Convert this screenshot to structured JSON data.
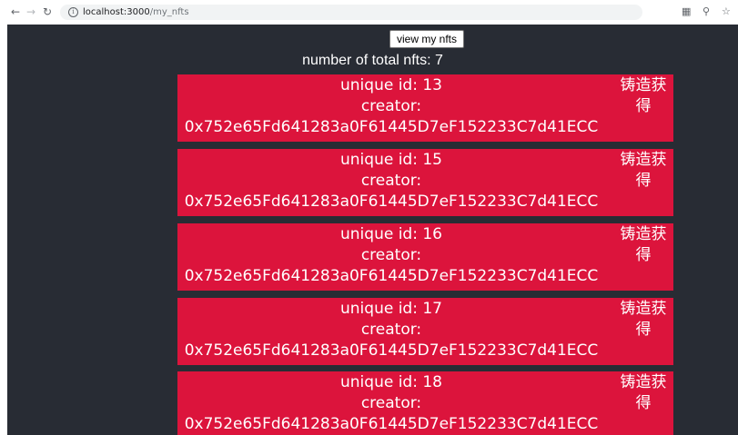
{
  "browser": {
    "url_host": "localhost:3000",
    "url_path": "/my_nfts"
  },
  "app": {
    "view_button_label": "view my nfts",
    "total_text": "number of total nfts: 7",
    "nfts": [
      {
        "id_text": "unique id: 13",
        "creator_label": "creator:",
        "creator_address": "0x752e65Fd641283a0F61445D7eF152233C7d41ECC",
        "status_line1": "铸造获",
        "status_line2": "得"
      },
      {
        "id_text": "unique id: 15",
        "creator_label": "creator:",
        "creator_address": "0x752e65Fd641283a0F61445D7eF152233C7d41ECC",
        "status_line1": "铸造获",
        "status_line2": "得"
      },
      {
        "id_text": "unique id: 16",
        "creator_label": "creator:",
        "creator_address": "0x752e65Fd641283a0F61445D7eF152233C7d41ECC",
        "status_line1": "铸造获",
        "status_line2": "得"
      },
      {
        "id_text": "unique id: 17",
        "creator_label": "creator:",
        "creator_address": "0x752e65Fd641283a0F61445D7eF152233C7d41ECC",
        "status_line1": "铸造获",
        "status_line2": "得"
      },
      {
        "id_text": "unique id: 18",
        "creator_label": "creator:",
        "creator_address": "0x752e65Fd641283a0F61445D7eF152233C7d41ECC",
        "status_line1": "铸造获",
        "status_line2": "得"
      }
    ]
  },
  "colors": {
    "background": "#282c34",
    "card": "#dc143c",
    "text": "#ffffff"
  },
  "icons": {
    "back": "arrow-left-icon",
    "forward": "arrow-right-icon",
    "reload": "reload-icon",
    "info": "info-icon",
    "translate": "translate-icon",
    "zoom": "zoom-icon",
    "bookmark": "star-icon"
  }
}
